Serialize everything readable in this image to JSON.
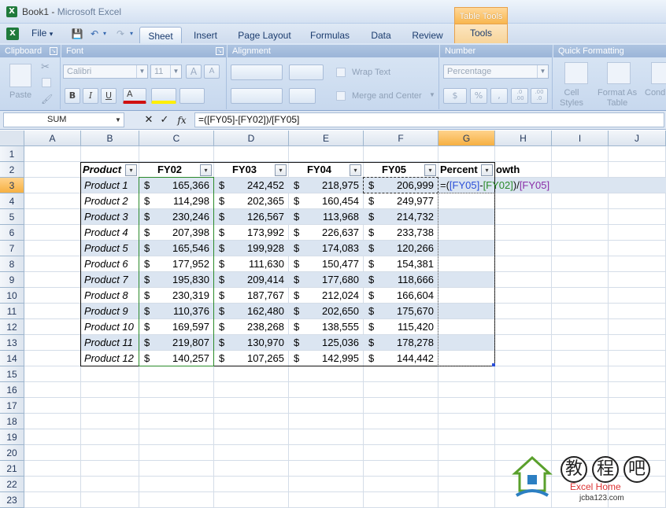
{
  "window": {
    "title_prefix": "Book1 - ",
    "title_app": "Microsoft Excel",
    "app_letter": "X"
  },
  "context_tab": {
    "header": "Table Tools",
    "tab": "Tools"
  },
  "file_menu": {
    "label": "File",
    "arrow": "▾"
  },
  "quick_access": {
    "save": "💾",
    "undo": "↶",
    "redo": "↷",
    "more": "▾"
  },
  "tabs": [
    "Sheet",
    "Insert",
    "Page Layout",
    "Formulas",
    "Data",
    "Review"
  ],
  "ribbon": {
    "groups": [
      "Clipboard",
      "Font",
      "Alignment",
      "Number",
      "Quick Formatting"
    ],
    "paste_label": "Paste",
    "font_name": "Calibri",
    "font_size": "11",
    "bold": "B",
    "italic": "I",
    "underline": "U",
    "wrap_text": "Wrap Text",
    "merge_center": "Merge and Center",
    "number_format": "Percentage",
    "currency": "$",
    "percent": "%",
    "comma": ",",
    "inc_decimal": ".0\n.00",
    "dec_decimal": ".00\n.0",
    "cell_styles": "Cell\nStyles",
    "format_as_table": "Format As\nTable",
    "conditional": "Cond"
  },
  "formula_bar": {
    "name_box": "SUM",
    "cancel": "✕",
    "enter": "✓",
    "fx": "fx",
    "formula": "=([FY05]-[FY02])/[FY05]"
  },
  "columns": [
    "A",
    "B",
    "C",
    "D",
    "E",
    "F",
    "G",
    "H",
    "I",
    "J"
  ],
  "rows": [
    "1",
    "2",
    "3",
    "4",
    "5",
    "6",
    "7",
    "8",
    "9",
    "10",
    "11",
    "12",
    "13",
    "14",
    "15",
    "16",
    "17",
    "18",
    "19",
    "20",
    "21",
    "22",
    "23"
  ],
  "table": {
    "headers": [
      "Product",
      "FY02",
      "FY03",
      "FY04",
      "FY05",
      "Percent",
      "owth"
    ],
    "dropdown_glyph": "▾",
    "currency": "$",
    "rows": [
      {
        "product": "Product 1",
        "fy02": "165,366",
        "fy03": "242,452",
        "fy04": "218,975",
        "fy05": "206,999"
      },
      {
        "product": "Product 2",
        "fy02": "114,298",
        "fy03": "202,365",
        "fy04": "160,454",
        "fy05": "249,977"
      },
      {
        "product": "Product 3",
        "fy02": "230,246",
        "fy03": "126,567",
        "fy04": "113,968",
        "fy05": "214,732"
      },
      {
        "product": "Product 4",
        "fy02": "207,398",
        "fy03": "173,992",
        "fy04": "226,637",
        "fy05": "233,738"
      },
      {
        "product": "Product 5",
        "fy02": "165,546",
        "fy03": "199,928",
        "fy04": "174,083",
        "fy05": "120,266"
      },
      {
        "product": "Product 6",
        "fy02": "177,952",
        "fy03": "111,630",
        "fy04": "150,477",
        "fy05": "154,381"
      },
      {
        "product": "Product 7",
        "fy02": "195,830",
        "fy03": "209,414",
        "fy04": "177,680",
        "fy05": "118,666"
      },
      {
        "product": "Product 8",
        "fy02": "230,319",
        "fy03": "187,767",
        "fy04": "212,024",
        "fy05": "166,604"
      },
      {
        "product": "Product 9",
        "fy02": "110,376",
        "fy03": "162,480",
        "fy04": "202,650",
        "fy05": "175,670"
      },
      {
        "product": "Product 10",
        "fy02": "169,597",
        "fy03": "238,268",
        "fy04": "138,555",
        "fy05": "115,420"
      },
      {
        "product": "Product 11",
        "fy02": "219,807",
        "fy03": "130,970",
        "fy04": "125,036",
        "fy05": "178,278"
      },
      {
        "product": "Product 12",
        "fy02": "140,257",
        "fy03": "107,265",
        "fy04": "142,995",
        "fy05": "144,442"
      }
    ],
    "editing_formula": {
      "open": "=(",
      "ref1": "[FY05]",
      "minus": "-",
      "ref2": "[FY02]",
      "close": ")/",
      "ref3": "[FY05]"
    }
  },
  "watermark": {
    "chars": [
      "教",
      "程",
      "吧"
    ],
    "sub": "Excel Home",
    "url": "jcba123.com"
  },
  "colors": {
    "accent": "#f6b042",
    "band": "#dbe5f1",
    "ref_blue": "#2b4fd8",
    "ref_green": "#2a8a2a",
    "ref_purple": "#8a2ea8"
  }
}
